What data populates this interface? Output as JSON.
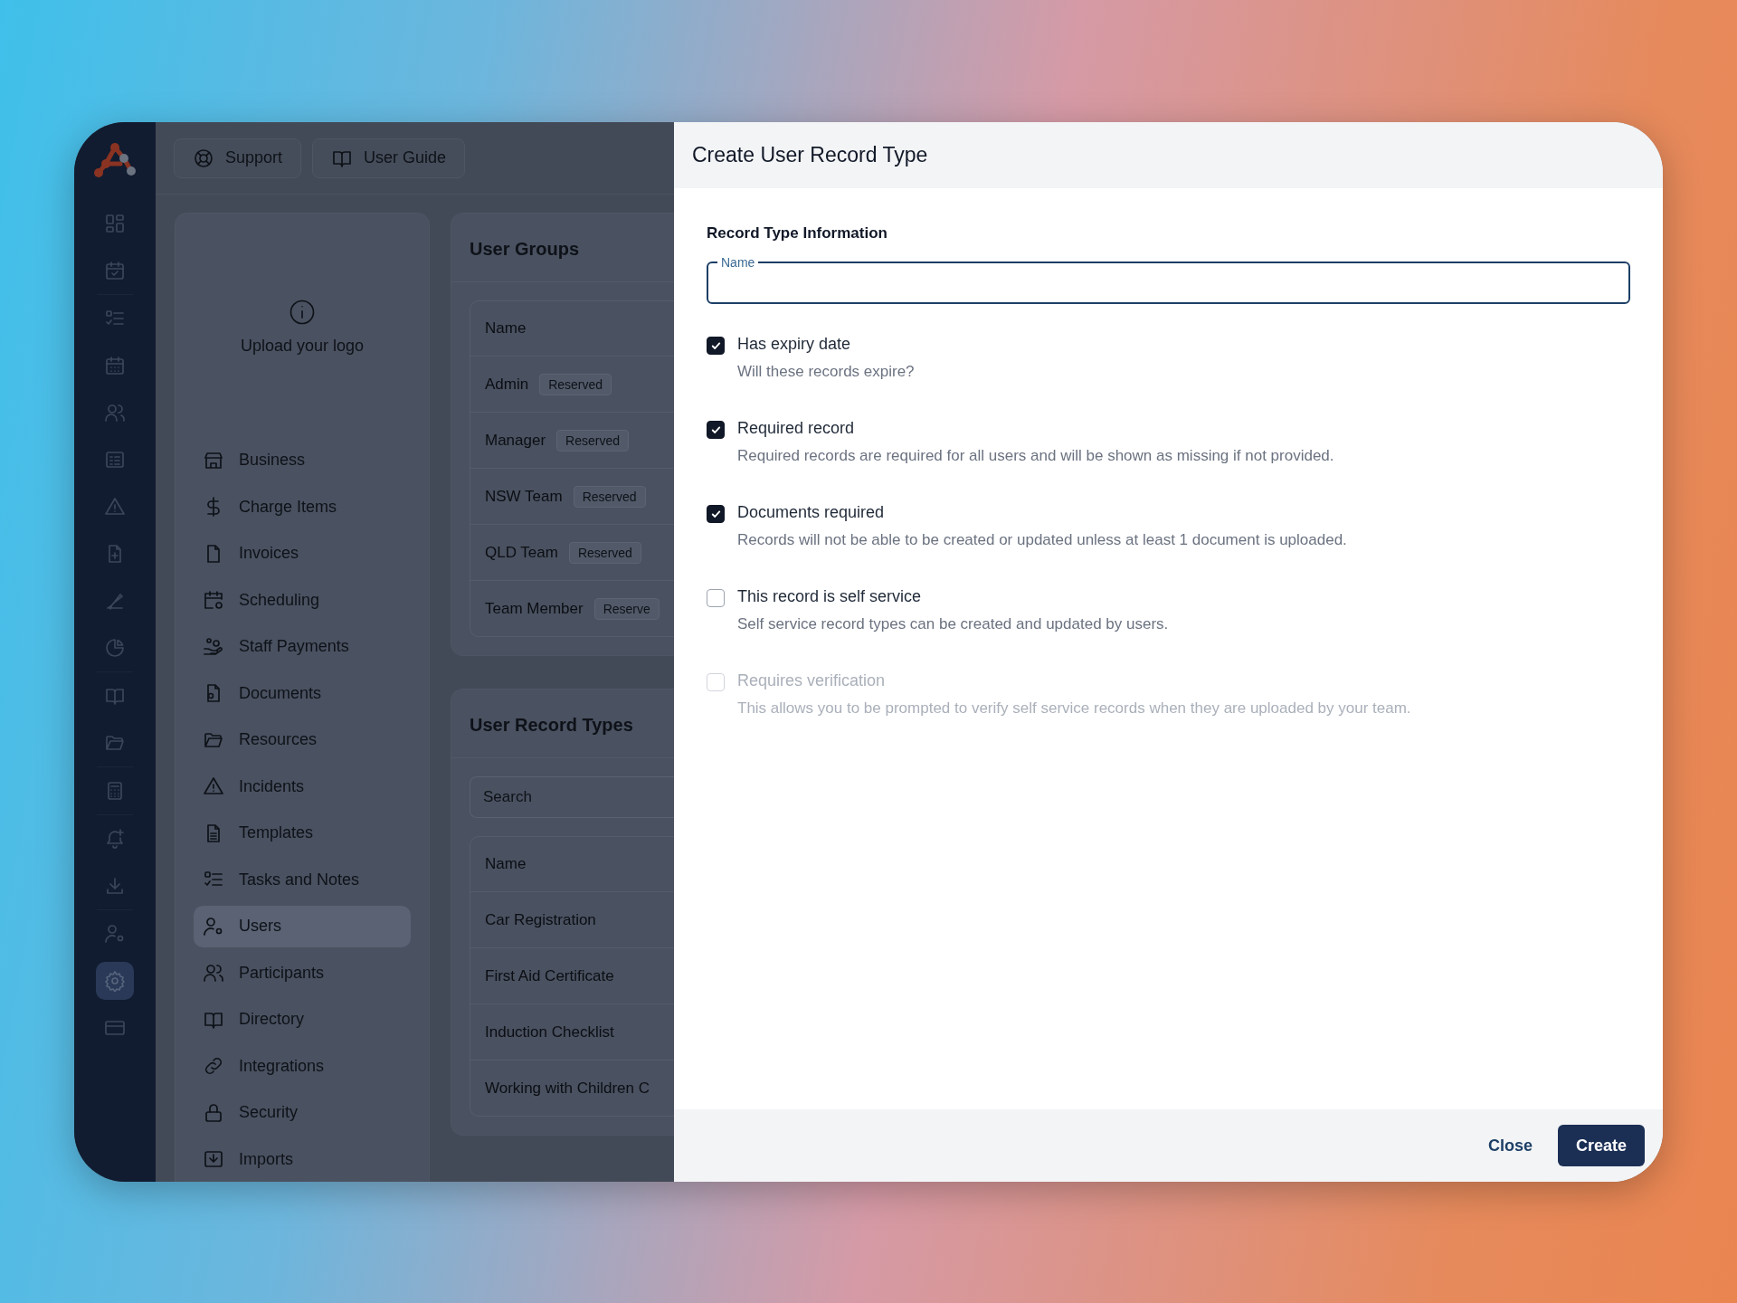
{
  "rail": [
    {
      "selected": false
    },
    {
      "selected": false
    },
    {
      "selected": false
    },
    {
      "selected": false
    },
    {
      "selected": false
    },
    {
      "selected": false
    },
    {
      "selected": false
    },
    {
      "selected": false
    },
    {
      "selected": false
    },
    {
      "selected": false
    },
    {
      "selected": false
    },
    {
      "selected": false
    },
    {
      "selected": false
    },
    {
      "selected": false
    },
    {
      "selected": false
    },
    {
      "selected": false
    },
    {
      "selected": true
    },
    {
      "selected": false
    }
  ],
  "top_bar": {
    "buttons": [
      {
        "label": "Support"
      },
      {
        "label": "User Guide"
      }
    ]
  },
  "settings_menu": {
    "logo_prompt": "Upload your logo",
    "items": [
      {
        "label": "Business",
        "selected": false
      },
      {
        "label": "Charge Items",
        "selected": false
      },
      {
        "label": "Invoices",
        "selected": false
      },
      {
        "label": "Scheduling",
        "selected": false
      },
      {
        "label": "Staff Payments",
        "selected": false
      },
      {
        "label": "Documents",
        "selected": false
      },
      {
        "label": "Resources",
        "selected": false
      },
      {
        "label": "Incidents",
        "selected": false
      },
      {
        "label": "Templates",
        "selected": false
      },
      {
        "label": "Tasks and Notes",
        "selected": false
      },
      {
        "label": "Users",
        "selected": true
      },
      {
        "label": "Participants",
        "selected": false
      },
      {
        "label": "Directory",
        "selected": false
      },
      {
        "label": "Integrations",
        "selected": false
      },
      {
        "label": "Security",
        "selected": false
      },
      {
        "label": "Imports",
        "selected": false
      }
    ]
  },
  "user_groups": {
    "title": "User Groups",
    "columns": [
      "Name"
    ],
    "rows": [
      {
        "name": "Admin",
        "badge": "Reserved"
      },
      {
        "name": "Manager",
        "badge": "Reserved"
      },
      {
        "name": "NSW Team",
        "badge": "Reserved"
      },
      {
        "name": "QLD Team",
        "badge": "Reserved"
      },
      {
        "name": "Team Member",
        "badge": "Reserve"
      }
    ]
  },
  "user_record_types": {
    "title": "User Record Types",
    "search": {
      "placeholder": "Search"
    },
    "columns": [
      "Name"
    ],
    "rows": [
      "Car Registration",
      "First Aid Certificate",
      "Induction Checklist",
      "Working with Children C"
    ]
  },
  "dialog": {
    "title": "Create User Record Type",
    "section_title": "Record Type Information",
    "name_field": {
      "label": "Name"
    },
    "options": [
      {
        "label": "Has expiry date",
        "description": "Will these records expire?",
        "checked": true,
        "disabled": false
      },
      {
        "label": "Required record",
        "description": "Required records are required for all users and will be shown as missing if not provided.",
        "checked": true,
        "disabled": false
      },
      {
        "label": "Documents required",
        "description": "Records will not be able to be created or updated unless at least 1 document is uploaded.",
        "checked": true,
        "disabled": false
      },
      {
        "label": "This record is self service",
        "description": "Self service record types can be created and updated by users.",
        "checked": false,
        "disabled": false
      },
      {
        "label": "Requires verification",
        "description": "This allows you to be prompted to verify self service records when they are uploaded by your team.",
        "checked": false,
        "disabled": true
      }
    ],
    "buttons": [
      {
        "label": "Close",
        "kind": "link"
      },
      {
        "label": "Create",
        "kind": "primary"
      }
    ]
  }
}
